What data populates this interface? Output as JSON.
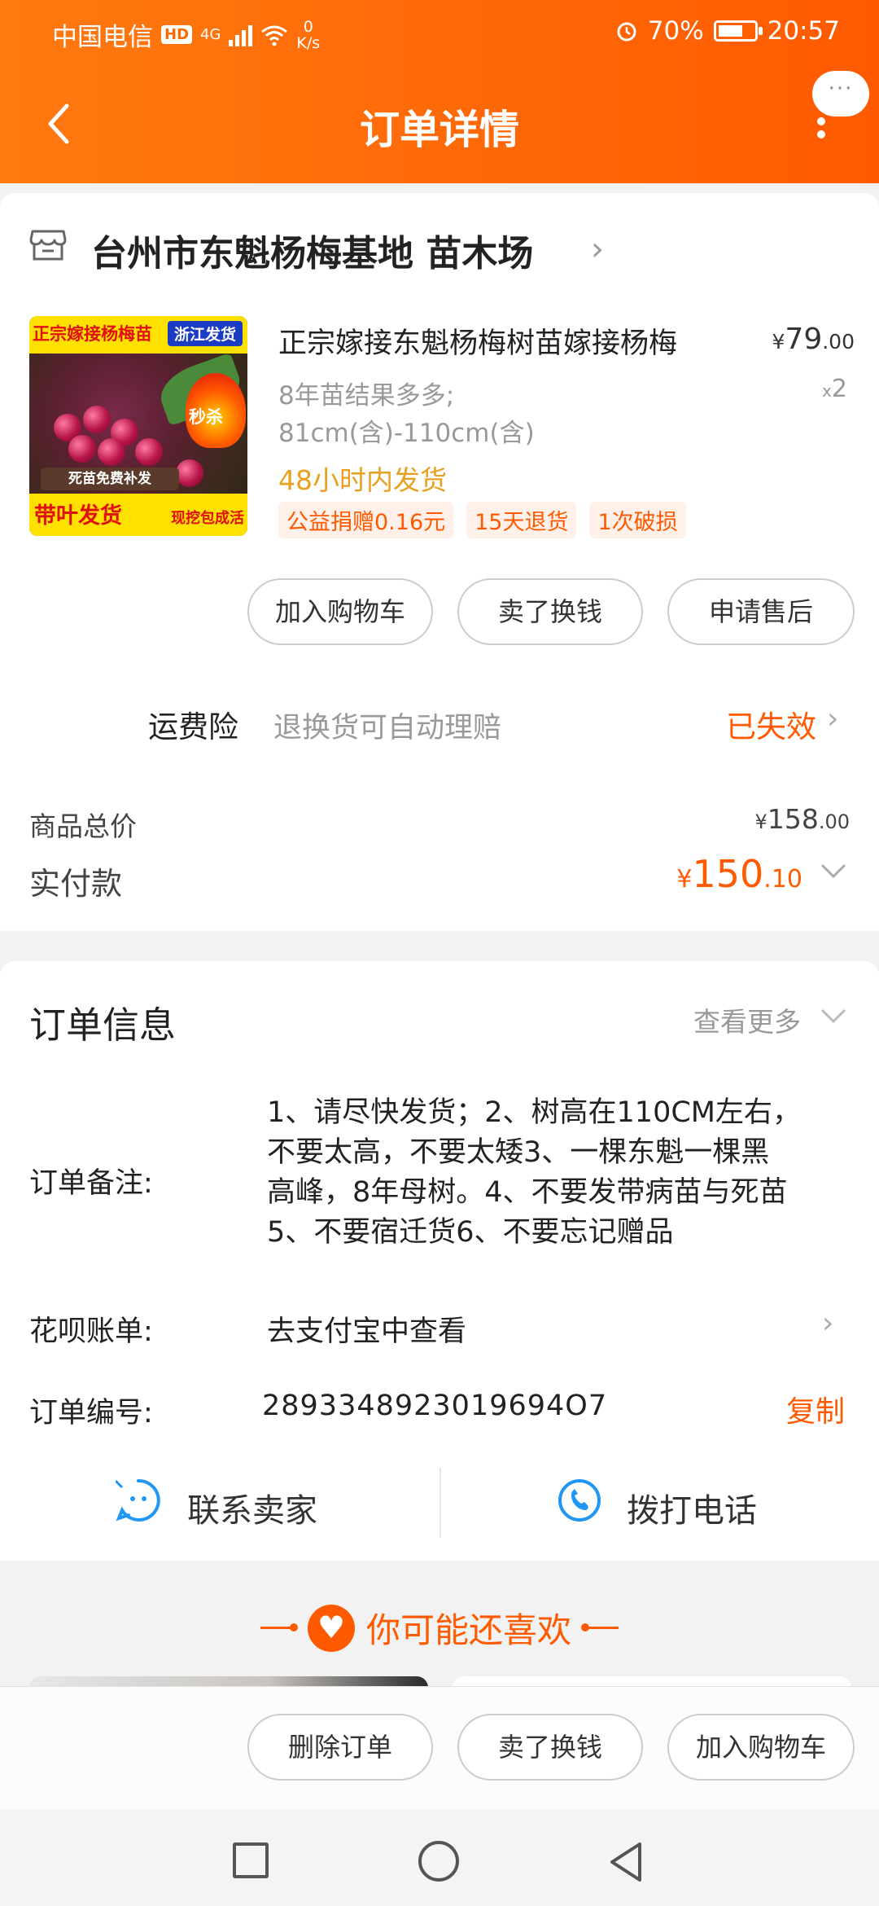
{
  "status_bar": {
    "carrier": "中国电信",
    "hd": "HD",
    "net_gen": "4G",
    "net_speed_value": "0",
    "net_speed_unit": "K/s",
    "battery_percent": "70%",
    "time": "20:57",
    "battery_level": 0.7
  },
  "header": {
    "title": "订单详情",
    "more_bubble": "···"
  },
  "shop": {
    "name": "台州市东魁杨梅基地 苗木场"
  },
  "product": {
    "image_text": {
      "top_left": "正宗嫁接杨梅苗",
      "top_right": "浙江发货",
      "flash_sale": "秒杀",
      "band": "死苗免费补发",
      "bottom_main": "带叶发货",
      "bottom_sub": "现挖包成活"
    },
    "title": "正宗嫁接东魁杨梅树苗嫁接杨梅",
    "price_currency": "¥",
    "price_int": "79",
    "price_dec": ".00",
    "spec_line1": "8年苗结果多多;",
    "spec_line2": "81cm(含)-110cm(含)",
    "qty_prefix": "x",
    "qty": "2",
    "shipping": "48小时内发货",
    "tags": [
      "公益捐赠0.16元",
      "15天退货",
      "1次破损"
    ]
  },
  "item_actions": {
    "add_to_cart": "加入购物车",
    "resell": "卖了换钱",
    "after_sale": "申请售后"
  },
  "insurance": {
    "label": "运费险",
    "desc": "退换货可自动理赔",
    "status": "已失效"
  },
  "totals": {
    "goods_total_label": "商品总价",
    "goods_total_currency": "¥",
    "goods_total_int": "158",
    "goods_total_dec": ".00",
    "paid_label": "实付款",
    "paid_currency": "¥",
    "paid_int": "150",
    "paid_dec": ".10"
  },
  "order_info": {
    "title": "订单信息",
    "see_more": "查看更多",
    "note_label": "订单备注:",
    "note_lines": [
      "1、请尽快发货；2、树高在110CM左右，",
      "不要太高，不要太矮3、一棵东魁一棵黑",
      "高峰，8年母树。4、不要发带病苗与死苗",
      "5、不要宿迁货6、不要忘记赠品"
    ],
    "huabei_label": "花呗账单:",
    "huabei_value": "去支付宝中查看",
    "order_no_label": "订单编号:",
    "order_no": "2893348923019694O7",
    "copy": "复制"
  },
  "contact": {
    "seller": "联系卖家",
    "call": "拨打电话"
  },
  "recommend": {
    "title": "你可能还喜欢"
  },
  "bottom_actions": {
    "delete": "删除订单",
    "resell": "卖了换钱",
    "add_to_cart": "加入购物车"
  },
  "colors": {
    "accent": "#ff5a00",
    "header_start": "#ff7a10",
    "ship_text": "#e8a020"
  }
}
